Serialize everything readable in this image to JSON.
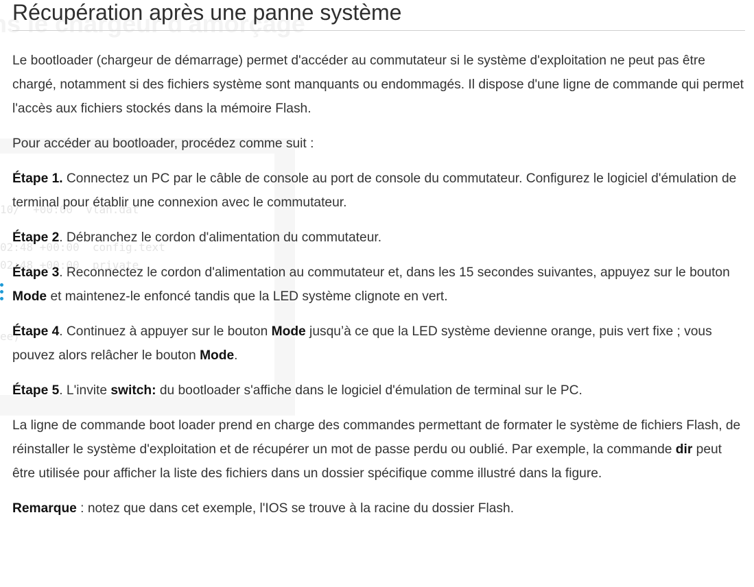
{
  "ghost": {
    "heading": "ns le chargeur d'amorçage",
    "code_lines": [
      "10/  +00:00  vlan.dat",
      "02:48 +00:00  config.text",
      "02:48 +00:00  private",
      "ee)"
    ]
  },
  "article": {
    "title": "Récupération après une panne système",
    "intro": "Le bootloader (chargeur de démarrage) permet d'accéder au commutateur si le système d'exploitation ne peut pas être chargé, notamment si des fichiers système sont manquants ou endommagés. Il dispose d'une ligne de commande qui permet l'accès aux fichiers stockés dans la mémoire Flash.",
    "access_lead": "Pour accéder au bootloader, procédez comme suit :",
    "steps": [
      {
        "label": "Étape 1.",
        "text": " Connectez un PC par le câble de console au port de console du commutateur. Configurez le logiciel d'émulation de terminal pour établir une connexion avec le commutateur."
      },
      {
        "label": "Étape 2",
        "text": ". Débranchez le cordon d'alimentation du commutateur."
      },
      {
        "label": "Étape 3",
        "text_a": ". Reconnectez le cordon d'alimentation au commutateur et, dans les 15 secondes suivantes, appuyez sur le bouton ",
        "mode": "Mode",
        "text_b": " et maintenez-le enfoncé tandis que la LED système clignote en vert."
      },
      {
        "label": "Étape 4",
        "text_a": ". Continuez à appuyer sur le bouton ",
        "mode1": "Mode",
        "text_b": " jusqu’à ce que la LED système devienne orange, puis vert fixe ; vous pouvez alors relâcher le bouton ",
        "mode2": "Mode",
        "text_c": "."
      },
      {
        "label": "Étape 5",
        "text_a": ". L'invite ",
        "prompt": "switch:",
        "text_b": " du bootloader s'affiche dans le logiciel d'émulation de terminal sur le PC."
      }
    ],
    "commands_a": "La ligne de commande boot loader prend en charge des commandes permettant de formater le système de fichiers Flash, de réinstaller le système d'exploitation et de récupérer un mot de passe perdu ou oublié. Par exemple, la commande ",
    "dir_cmd": "dir",
    "commands_b": " peut être utilisée pour afficher la liste des fichiers dans un dossier spécifique comme illustré dans la figure.",
    "note_label": "Remarque",
    "note_text": " : notez que dans cet exemple, l'IOS se trouve à la racine du dossier Flash."
  }
}
